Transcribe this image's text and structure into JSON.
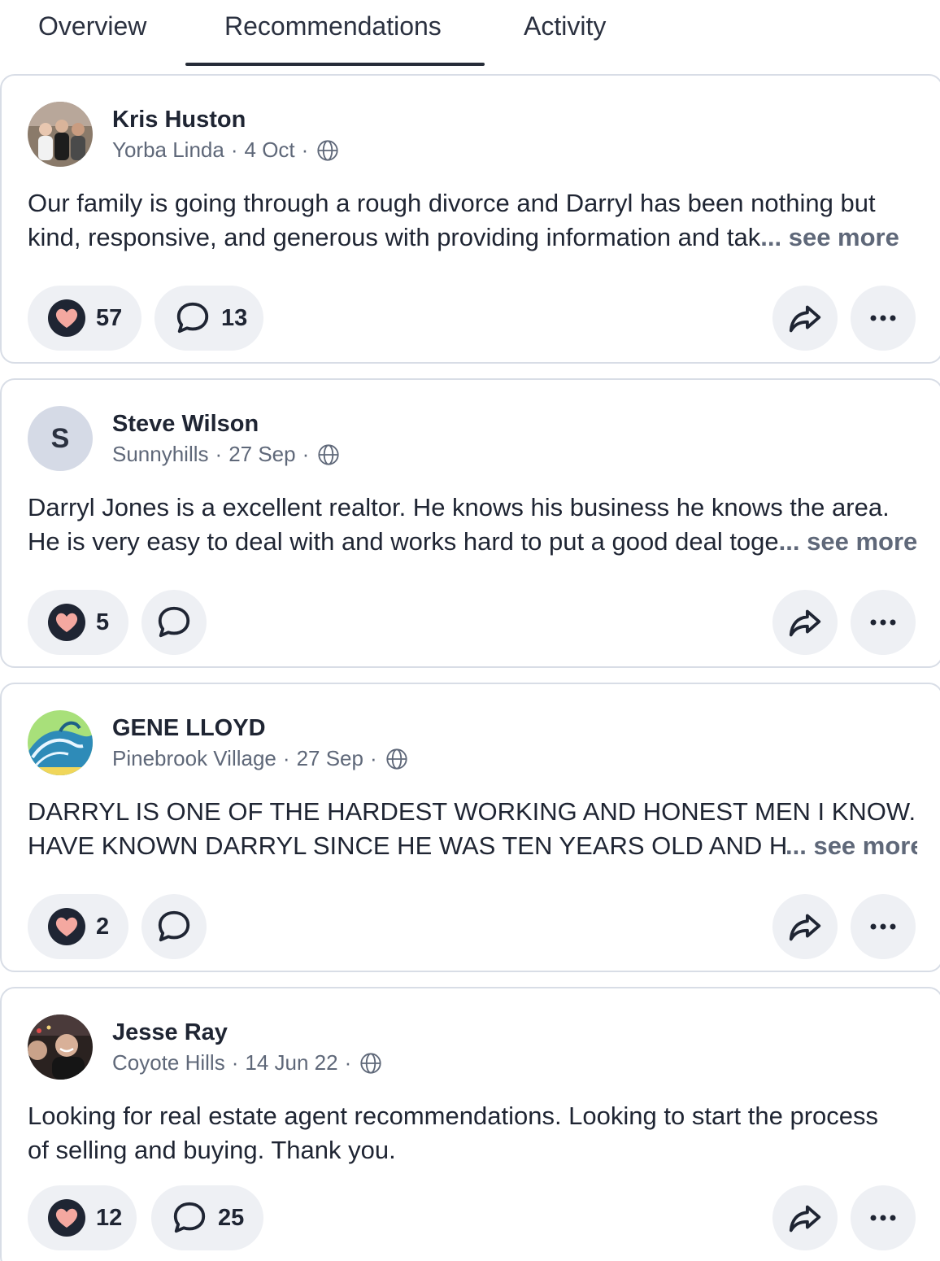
{
  "tabs": [
    {
      "label": "Overview"
    },
    {
      "label": "Recommendations",
      "active": true
    },
    {
      "label": "Activity"
    }
  ],
  "posts": [
    {
      "author": "Kris Huston",
      "location": "Yorba Linda",
      "date": "4 Oct",
      "line1": "Our family is going through a rough divorce and Darryl has been nothing but",
      "line2": "kind, responsive, and generous with providing information and tak",
      "see_more": "... see more",
      "likes": "57",
      "comments": "13",
      "avatar_icon": "user-photo-avatar"
    },
    {
      "author": "Steve Wilson",
      "location": "Sunnyhills",
      "date": "27 Sep",
      "avatar_letter": "S",
      "line1": "Darryl Jones is a excellent realtor. He knows his business he knows the area.",
      "line2": "He is very easy to deal with and works hard to put a good deal toge",
      "see_more": "... see more",
      "likes": "5",
      "comments": ""
    },
    {
      "author": "GENE LLOYD",
      "location": "Pinebrook Village",
      "date": "27 Sep",
      "line1": "DARRYL IS ONE OF THE HARDEST WORKING AND HONEST MEN I KNOW....I",
      "line2": "HAVE KNOWN DARRYL SINCE HE WAS TEN YEARS OLD AND HE I",
      "see_more": "... see more",
      "likes": "2",
      "comments": "",
      "avatar_icon": "wave-picture-avatar"
    },
    {
      "author": "Jesse Ray",
      "location": "Coyote Hills",
      "date": "14 Jun 22",
      "line1": "Looking for real estate agent recommendations. Looking to start the process",
      "line2": "of selling and buying. Thank you.",
      "likes": "12",
      "comments": "25",
      "avatar_icon": "user-photo-avatar"
    }
  ],
  "icons": {
    "like": "heart-icon",
    "comment": "speech-bubble-icon",
    "share": "share-arrow-icon",
    "more": "ellipsis-icon",
    "visibility": "globe-icon"
  },
  "colors": {
    "heart": "#f4a8a0",
    "heart_outline": "#1f2533",
    "pill_bg": "#eef0f4",
    "muted_text": "#5f6879",
    "tab_underline": "#262c38"
  }
}
